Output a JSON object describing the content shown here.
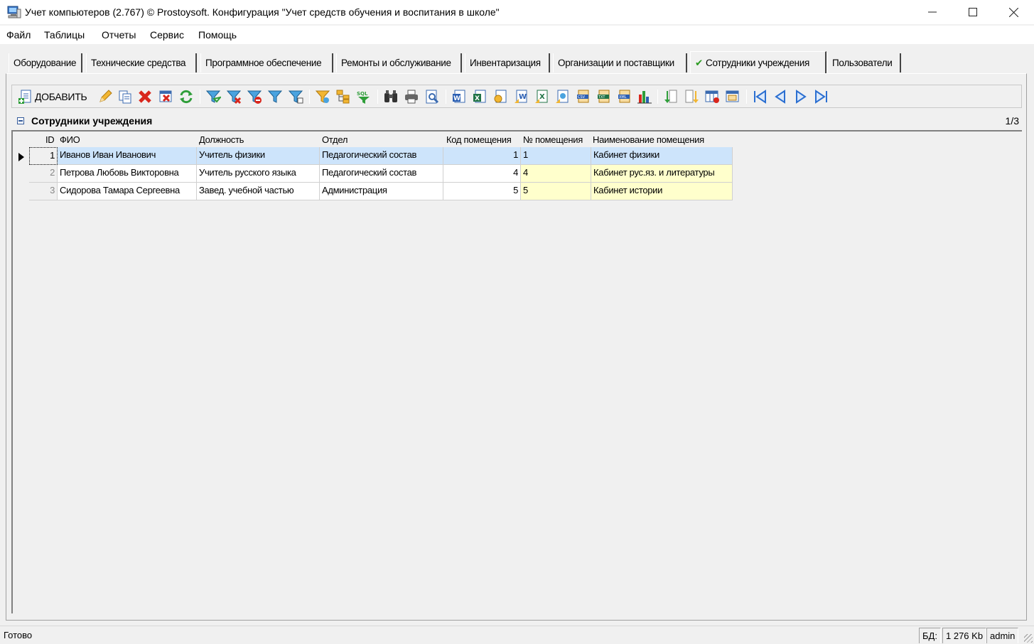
{
  "window": {
    "title": "Учет компьютеров (2.767) © Prostoysoft. Конфигурация \"Учет средств обучения и воспитания в школе\"",
    "minimize": "—",
    "maximize": "☐",
    "close": "✕"
  },
  "menu": [
    "Файл",
    "Таблицы",
    "Отчеты",
    "Сервис",
    "Помощь"
  ],
  "tabs": [
    {
      "label": "Оборудование"
    },
    {
      "label": "Технические средства"
    },
    {
      "label": "Программное обеспечение"
    },
    {
      "label": "Ремонты и обслуживание"
    },
    {
      "label": "Инвентаризация"
    },
    {
      "label": "Организации и поставщики"
    },
    {
      "label": "Сотрудники учреждения",
      "check": "✔"
    },
    {
      "label": "Пользователи"
    }
  ],
  "toolbar": {
    "add_label": "ДОБАВИТЬ",
    "icons": [
      "add-record-icon",
      "edit-pencil-icon",
      "copy-record-icon",
      "delete-icon",
      "delete-all-icon",
      "refresh-icon",
      "filter-icon",
      "filter-remove-icon",
      "filter-clear-icon",
      "filter-selection-icon",
      "filter-form-icon",
      "filter-advanced-icon",
      "tree-group-icon",
      "sql-query-icon",
      "find-binoculars-icon",
      "print-icon",
      "print-preview-icon",
      "export-word-icon",
      "export-excel-icon",
      "export-html-icon",
      "export-rtf-icon",
      "export-xls-icon",
      "export-image-icon",
      "export-csv-icon",
      "export-txt-icon",
      "export-xml-icon",
      "chart-icon",
      "sort-asc-icon",
      "sort-desc-icon",
      "columns-icon",
      "grid-settings-icon",
      "first-record-icon",
      "prev-record-icon",
      "next-record-icon",
      "last-record-icon"
    ]
  },
  "grid": {
    "caption": "Сотрудники учреждения",
    "counter": "1/3",
    "columns": [
      "ID",
      "ФИО",
      "Должность",
      "Отдел",
      "Код помещения",
      "№ помещения",
      "Наименование помещения"
    ],
    "rows": [
      {
        "id": "1",
        "fio": "Иванов Иван Иванович",
        "position": "Учитель физики",
        "dept": "Педагогический состав",
        "room_code": "1",
        "room_no": "1",
        "room_name": "Кабинет физики"
      },
      {
        "id": "2",
        "fio": "Петрова Любовь Викторовна",
        "position": "Учитель русского языка",
        "dept": "Педагогический состав",
        "room_code": "4",
        "room_no": "4",
        "room_name": "Кабинет рус.яз. и литературы"
      },
      {
        "id": "3",
        "fio": "Сидорова Тамара Сергеевна",
        "position": "Завед. учебной частью",
        "dept": "Администрация",
        "room_code": "5",
        "room_no": "5",
        "room_name": "Кабинет истории"
      }
    ]
  },
  "status": {
    "ready": "Готово",
    "db_label": "БД:",
    "db_size": "1 276 Kb",
    "user": "admin"
  },
  "colors": {
    "selected_row": "#cde4fb",
    "lookup_cell": "#ffffcc",
    "check": "#2a9a1f"
  }
}
